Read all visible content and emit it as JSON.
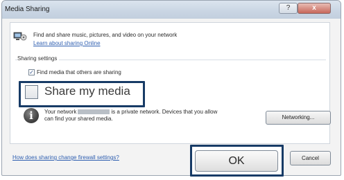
{
  "window": {
    "title": "Media Sharing",
    "help_label": "?",
    "close_label": "x"
  },
  "intro": {
    "text": "Find and share music, pictures, and video on your network",
    "learn_link": "Learn about sharing Online"
  },
  "sharing_settings": {
    "group_label": "Sharing settings",
    "find_media": {
      "label": "Find media that others are sharing",
      "checked": true,
      "mark": "✓"
    },
    "share_my_media": {
      "label": "Share my media",
      "checked": false
    }
  },
  "network": {
    "text_prefix": "Your network",
    "text_suffix": "is a private network. Devices that you allow",
    "text_line2": "can find your shared media.",
    "info_glyph": "i",
    "networking_button": "Networking..."
  },
  "footer": {
    "firewall_link": "How does sharing change firewall settings?",
    "ok_button": "OK",
    "cancel_button": "Cancel"
  },
  "colors": {
    "highlight_border": "#173b66",
    "link": "#2f5fb0"
  }
}
